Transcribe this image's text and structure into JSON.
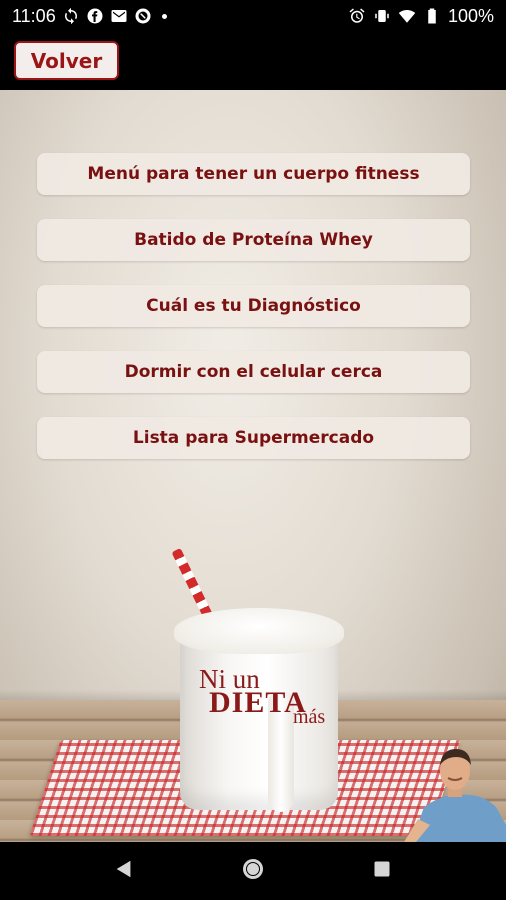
{
  "status_bar": {
    "time": "11:06",
    "battery": "100%",
    "left_icons": [
      "sync-icon",
      "facebook-icon",
      "gmail-icon",
      "app-icon"
    ],
    "right_icons": [
      "alarm-icon",
      "vibrate-icon",
      "wifi-icon",
      "battery-icon"
    ]
  },
  "app_bar": {
    "back_label": "Volver"
  },
  "menu": {
    "items": [
      {
        "label": "Menú para tener un cuerpo fitness"
      },
      {
        "label": "Batido de Proteína Whey"
      },
      {
        "label": "Cuál es tu Diagnóstico"
      },
      {
        "label": "Dormir con el celular cerca"
      },
      {
        "label": "Lista para Supermercado"
      }
    ]
  },
  "logo": {
    "line1": "Ni un",
    "line2": "DIETA",
    "line3": "más"
  },
  "colors": {
    "accent": "#9a1515",
    "button_bg": "#f0eae3"
  },
  "nav_bar": {
    "icons": [
      "back-nav-icon",
      "home-nav-icon",
      "recents-nav-icon"
    ]
  }
}
